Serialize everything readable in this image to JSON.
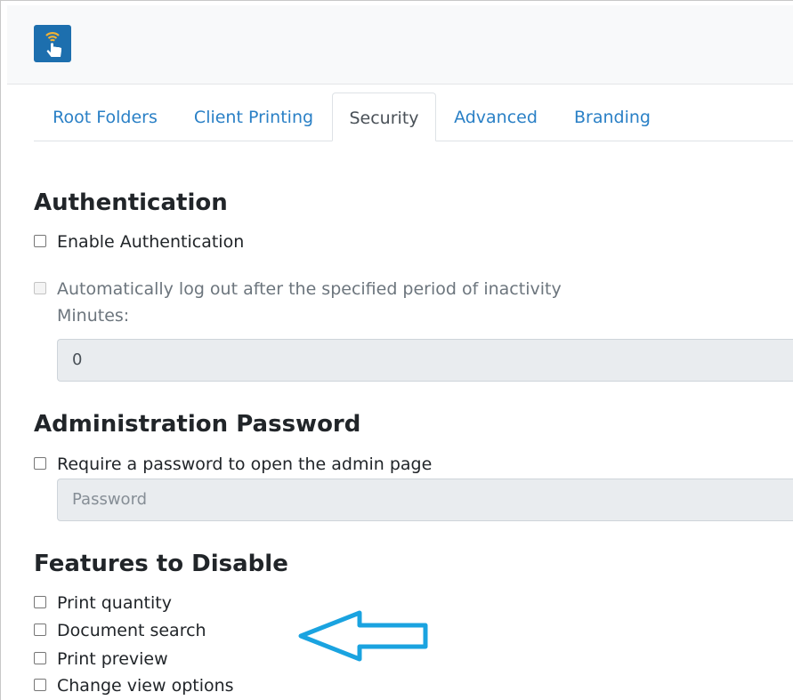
{
  "tabs": [
    {
      "label": "Root Folders",
      "active": false
    },
    {
      "label": "Client Printing",
      "active": false
    },
    {
      "label": "Security",
      "active": true
    },
    {
      "label": "Advanced",
      "active": false
    },
    {
      "label": "Branding",
      "active": false
    }
  ],
  "authentication": {
    "heading": "Authentication",
    "enable_label": "Enable Authentication",
    "enable_checked": false,
    "autologout_label": "Automatically log out after the specified period of inactivity",
    "autologout_enabled": false,
    "minutes_label": "Minutes:",
    "minutes_value": "0"
  },
  "admin_password": {
    "heading": "Administration Password",
    "require_label": "Require a password to open the admin page",
    "require_checked": false,
    "password_placeholder": "Password"
  },
  "features": {
    "heading": "Features to Disable",
    "items": [
      {
        "label": "Print quantity",
        "checked": false
      },
      {
        "label": "Document search",
        "checked": false
      },
      {
        "label": "Print preview",
        "checked": false
      },
      {
        "label": "Change view options",
        "checked": false
      }
    ]
  },
  "colors": {
    "link": "#2a80c6",
    "logo_bg": "#1d6fae",
    "arrow": "#1aa3e0"
  },
  "icons": {
    "logo": "touch-wireless-icon",
    "annotation": "arrow-left-outline-icon"
  }
}
